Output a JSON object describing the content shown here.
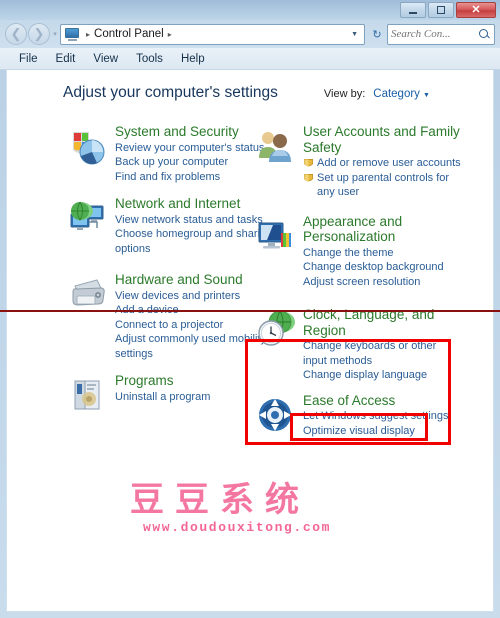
{
  "window": {
    "controls": {
      "minimize": "Minimize",
      "maximize": "Maximize",
      "close": "Close",
      "close_glyph": "✕"
    }
  },
  "nav": {
    "back": "Back",
    "forward": "Forward",
    "breadcrumb_icon": "control-panel-icon",
    "breadcrumb": "Control Panel",
    "separator": "▸",
    "dropdown_caret": "▼",
    "refresh": "↻"
  },
  "search": {
    "placeholder": "Search Con...",
    "value": "",
    "icon": "search-icon"
  },
  "menu": {
    "items": [
      "File",
      "Edit",
      "View",
      "Tools",
      "Help"
    ]
  },
  "page": {
    "title": "Adjust your computer's settings",
    "view_by_label": "View by:",
    "view_by_value": "Category",
    "view_by_caret": "▼"
  },
  "categories": {
    "left": [
      {
        "icon": "shield-pie-icon",
        "title": "System and Security",
        "links": [
          "Review your computer's status",
          "Back up your computer",
          "Find and fix problems"
        ]
      },
      {
        "icon": "globe-monitors-icon",
        "title": "Network and Internet",
        "links": [
          "View network status and tasks",
          "Choose homegroup and sharing options"
        ]
      },
      {
        "icon": "printer-icon",
        "title": "Hardware and Sound",
        "links": [
          "View devices and printers",
          "Add a device",
          "Connect to a projector",
          "Adjust commonly used mobility settings"
        ]
      },
      {
        "icon": "programs-box-icon",
        "title": "Programs",
        "links": [
          "Uninstall a program"
        ]
      }
    ],
    "right": [
      {
        "icon": "two-users-icon",
        "title": "User Accounts and Family Safety",
        "links": [
          "Add or remove user accounts",
          "Set up parental controls for any user"
        ],
        "shielded_links": [
          0,
          1
        ]
      },
      {
        "icon": "monitor-color-icon",
        "title": "Appearance and Personalization",
        "links": [
          "Change the theme",
          "Change desktop background",
          "Adjust screen resolution"
        ]
      },
      {
        "icon": "clock-globe-icon",
        "title": "Clock, Language, and Region",
        "links": [
          "Change keyboards or other input methods",
          "Change display language"
        ]
      },
      {
        "icon": "ease-of-access-icon",
        "title": "Ease of Access",
        "links": [
          "Let Windows suggest settings",
          "Optimize visual display"
        ]
      }
    ]
  },
  "annotations": {
    "highlight_color": "#f10000",
    "divider_color": "#8b1010",
    "highlighted_category": "Clock, Language, and Region",
    "highlighted_link": "Change display language"
  },
  "watermark": {
    "brand": "豆豆系统",
    "url": "www.doudouxitong.com",
    "color": "#f25a8e"
  }
}
